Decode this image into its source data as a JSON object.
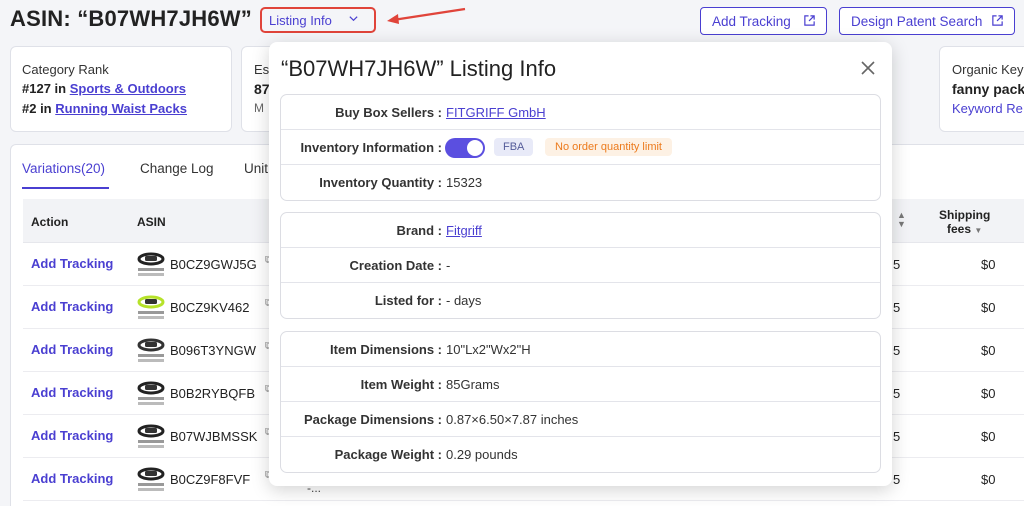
{
  "header": {
    "asin_title": "ASIN: “B07WH7JH6W”",
    "listing_info_label": "Listing Info",
    "add_tracking_label": "Add Tracking",
    "design_patent_label": "Design Patent Search"
  },
  "cards": {
    "rank": {
      "label": "Category Rank",
      "rows": [
        {
          "rank": "#127 in",
          "category": "Sports & Outdoors"
        },
        {
          "rank": "#2 in",
          "category": "Running Waist Packs"
        }
      ]
    },
    "est": {
      "label": "Es",
      "value": "87",
      "sub": "M"
    },
    "organic": {
      "label": "Organic Key",
      "value": "fanny pack",
      "link": "Keyword Re"
    }
  },
  "tabs": [
    {
      "label": "Variations(20)"
    },
    {
      "label": "Change Log"
    },
    {
      "label": "Unit"
    }
  ],
  "table": {
    "headers": {
      "action": "Action",
      "asin": "ASIN",
      "shipping_line1": "Shipping",
      "shipping_line2": "fees"
    },
    "rows": [
      {
        "action": "Add Tracking",
        "asin": "B0CZ9GWJ5G",
        "v5": "5",
        "ship": "$0",
        "band_color": "#222222"
      },
      {
        "action": "Add Tracking",
        "asin": "B0CZ9KV462",
        "v5": "5",
        "ship": "$0",
        "band_color": "#b6e22a"
      },
      {
        "action": "Add Tracking",
        "asin": "B096T3YNGW",
        "v5": "5",
        "ship": "$0",
        "band_color": "#333333"
      },
      {
        "action": "Add Tracking",
        "asin": "B0B2RYBQFB",
        "v5": "5",
        "ship": "$0",
        "band_color": "#222222"
      },
      {
        "action": "Add Tracking",
        "asin": "B07WJBMSSK",
        "v5": "5",
        "ship": "$0",
        "band_color": "#222222"
      },
      {
        "action": "Add Tracking",
        "asin": "B0CZ9F8FVF",
        "v5": "5",
        "ship": "$0",
        "band_color": "#222222"
      }
    ],
    "tail": "-..."
  },
  "popup": {
    "title": "“B07WH7JH6W”  Listing Info",
    "section1": {
      "buy_box_key": "Buy Box Sellers :",
      "buy_box_value": "FITGRIFF GmbH",
      "inventory_info_key": "Inventory Information :",
      "fba_tag": "FBA",
      "limit_tag": "No order quantity limit",
      "inventory_qty_key": "Inventory Quantity :",
      "inventory_qty_value": "15323"
    },
    "section2": {
      "brand_key": "Brand :",
      "brand_value": "Fitgriff",
      "creation_key": "Creation Date :",
      "creation_value": "-",
      "listed_key": "Listed for :",
      "listed_value": "- days"
    },
    "section3": {
      "item_dim_key": "Item Dimensions :",
      "item_dim_value": "10\"Lx2\"Wx2\"H",
      "item_weight_key": "Item Weight :",
      "item_weight_value": "85Grams",
      "pkg_dim_key": "Package Dimensions :",
      "pkg_dim_value": "0.87×6.50×7.87 inches",
      "pkg_weight_key": "Package Weight :",
      "pkg_weight_value": "0.29 pounds"
    }
  },
  "colors": {
    "accent": "#4a3fd1",
    "highlight_border": "#e0443a",
    "toggle_on": "#5b4fe0",
    "limit_tag": "#ec7a1c"
  }
}
